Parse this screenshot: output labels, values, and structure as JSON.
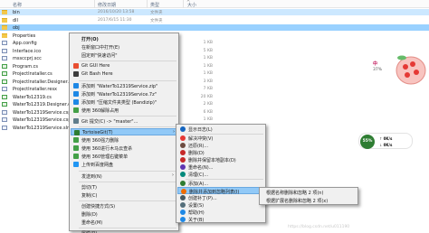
{
  "header": {
    "name": "名称",
    "date": "修改日期",
    "type": "类型",
    "size": "大小",
    "collapse": "^"
  },
  "files": [
    {
      "name": "bin",
      "date": "2016/10/20 13:58",
      "type": "文件夹",
      "size": "",
      "kind": "folder",
      "state": "sel"
    },
    {
      "name": "dll",
      "date": "2017/6/15 11:30",
      "type": "文件夹",
      "size": "",
      "kind": "folder",
      "state": ""
    },
    {
      "name": "obj",
      "date": "",
      "type": "",
      "size": "",
      "kind": "folder",
      "state": "sel-dark"
    },
    {
      "name": "Properties",
      "date": "",
      "type": "",
      "size": "",
      "kind": "folder",
      "state": ""
    },
    {
      "name": "App.config",
      "date": "",
      "type": "",
      "size": "1 KB",
      "kind": "file",
      "state": ""
    },
    {
      "name": "Interface.ico",
      "date": "",
      "type": "",
      "size": "5 KB",
      "kind": "file",
      "state": ""
    },
    {
      "name": "mssccprj.scc",
      "date": "",
      "type": "",
      "size": "1 KB",
      "kind": "file",
      "state": ""
    },
    {
      "name": "Program.cs",
      "date": "",
      "type": "",
      "size": "1 KB",
      "kind": "csfile",
      "state": ""
    },
    {
      "name": "ProjectInstaller.cs",
      "date": "",
      "type": "",
      "size": "1 KB",
      "kind": "csfile",
      "state": ""
    },
    {
      "name": "ProjectInstaller.Designer.cs",
      "date": "",
      "type": "",
      "size": "3 KB",
      "kind": "csfile",
      "state": ""
    },
    {
      "name": "ProjectInstaller.resx",
      "date": "",
      "type": "",
      "size": "7 KB",
      "kind": "file",
      "state": ""
    },
    {
      "name": "WaterTo12319.cs",
      "date": "",
      "type": "",
      "size": "20 KB",
      "kind": "csfile",
      "state": ""
    },
    {
      "name": "WaterTo12319.Designer.cs",
      "date": "",
      "type": "",
      "size": "2 KB",
      "kind": "csfile",
      "state": ""
    },
    {
      "name": "WaterTo12319Service.csp",
      "date": "",
      "type": "",
      "size": "6 KB",
      "kind": "file",
      "state": ""
    },
    {
      "name": "WaterTo12319Service.csp",
      "date": "",
      "type": "",
      "size": "1 KB",
      "kind": "file",
      "state": ""
    },
    {
      "name": "WaterTo12319Service.sln",
      "date": "",
      "type": "",
      "size": "1 KB",
      "kind": "file",
      "state": ""
    }
  ],
  "context_menu": {
    "items": [
      {
        "label": "打开(O)",
        "icon": "",
        "color": "",
        "bold": true,
        "arrow": false
      },
      {
        "label": "在新窗口中打开(E)",
        "icon": "",
        "color": "",
        "bold": false,
        "arrow": false
      },
      {
        "label": "固定到\"快速访问\"",
        "icon": "",
        "color": "",
        "bold": false,
        "arrow": false
      },
      {
        "label": "Git GUI Here",
        "icon": "git-gui-icon",
        "color": "#e84e31",
        "bold": false,
        "arrow": false
      },
      {
        "label": "Git Bash Here",
        "icon": "git-bash-icon",
        "color": "#3c3c3c",
        "bold": false,
        "arrow": false
      },
      {
        "label": "添加到 \"WaterTo12319Service.zip\"",
        "icon": "archive-icon",
        "color": "#1e88e5",
        "bold": false,
        "arrow": false
      },
      {
        "label": "添加到 \"WaterTo12319Service.7z\"",
        "icon": "archive-icon",
        "color": "#1e88e5",
        "bold": false,
        "arrow": false
      },
      {
        "label": "添加到 \"压缩文件夹类型 (Bandizip)\"",
        "icon": "archive-icon",
        "color": "#1e88e5",
        "bold": false,
        "arrow": false
      },
      {
        "label": "使用 360解除占用",
        "icon": "shield-360-icon",
        "color": "#43a047",
        "bold": false,
        "arrow": false
      },
      {
        "label": "Git 提交(C) -> \"master\"...",
        "icon": "git-commit-icon",
        "color": "#607d8b",
        "bold": false,
        "arrow": false
      },
      {
        "label": "TortoiseGit(T)",
        "icon": "tortoise-icon",
        "color": "#2e7d32",
        "bold": false,
        "arrow": true
      },
      {
        "label": "使用 360强力删除",
        "icon": "shield-360-icon",
        "color": "#43a047",
        "bold": false,
        "arrow": false
      },
      {
        "label": "使用 360进行木马云查杀",
        "icon": "shield-360-icon",
        "color": "#43a047",
        "bold": false,
        "arrow": false
      },
      {
        "label": "使用 360管理右键菜单",
        "icon": "shield-360-icon",
        "color": "#43a047",
        "bold": false,
        "arrow": false
      },
      {
        "label": "上传到百度网盘",
        "icon": "cloud-icon",
        "color": "#2196f3",
        "bold": false,
        "arrow": false
      },
      {
        "label": "发送到(N)",
        "icon": "",
        "color": "",
        "bold": false,
        "arrow": true
      },
      {
        "label": "剪切(T)",
        "icon": "",
        "color": "",
        "bold": false,
        "arrow": false
      },
      {
        "label": "复制(C)",
        "icon": "",
        "color": "",
        "bold": false,
        "arrow": false
      },
      {
        "label": "创建快捷方式(S)",
        "icon": "",
        "color": "",
        "bold": false,
        "arrow": false
      },
      {
        "label": "删除(D)",
        "icon": "",
        "color": "",
        "bold": false,
        "arrow": false
      },
      {
        "label": "重命名(M)",
        "icon": "",
        "color": "",
        "bold": false,
        "arrow": false
      },
      {
        "label": "属性(R)",
        "icon": "",
        "color": "",
        "bold": false,
        "arrow": false
      }
    ]
  },
  "tortoise_menu": {
    "items": [
      {
        "label": "显示日志(L)",
        "icon": "log-icon",
        "color": "#1565c0",
        "arrow": false
      },
      {
        "label": "解决冲突(V)",
        "icon": "resolve-icon",
        "color": "#e53935",
        "arrow": false
      },
      {
        "label": "还原(R)...",
        "icon": "revert-icon",
        "color": "#6d4c41",
        "arrow": false
      },
      {
        "label": "删除(D)",
        "icon": "delete-icon",
        "color": "#c62828",
        "arrow": false
      },
      {
        "label": "删除并保留本地副本(D)",
        "icon": "delete-keep-icon",
        "color": "#c62828",
        "arrow": false
      },
      {
        "label": "重命名(N)...",
        "icon": "rename-icon",
        "color": "#5e35b1",
        "arrow": false
      },
      {
        "label": "清理(C)...",
        "icon": "cleanup-icon",
        "color": "#00897b",
        "arrow": false
      },
      {
        "label": "添加(A)...",
        "icon": "add-icon",
        "color": "#2e7d32",
        "arrow": false
      },
      {
        "label": "删除并添加到忽略列表(I)",
        "icon": "ignore-icon",
        "color": "#ef6c00",
        "arrow": true
      },
      {
        "label": "创建补丁(P)...",
        "icon": "patch-icon",
        "color": "#455a64",
        "arrow": false
      },
      {
        "label": "设置(S)",
        "icon": "settings-icon",
        "color": "#546e7a",
        "arrow": false
      },
      {
        "label": "帮助(H)",
        "icon": "help-icon",
        "color": "#1e88e5",
        "arrow": false
      },
      {
        "label": "关于(B)",
        "icon": "about-icon",
        "color": "#1e88e5",
        "arrow": false
      }
    ]
  },
  "ignore_menu": {
    "items": [
      {
        "label": "根据名称删除和忽略 2 项(n)"
      },
      {
        "label": "根据扩展名删除和忽略 2 项(x)"
      }
    ]
  },
  "desktop": {
    "bubble_text": "中",
    "bubble_percent": "37%",
    "net_percent": "55%",
    "net_up_value": "0K/s",
    "net_down_value": "0K/s",
    "watermark": "https://blog.csdn.net/u011190"
  }
}
